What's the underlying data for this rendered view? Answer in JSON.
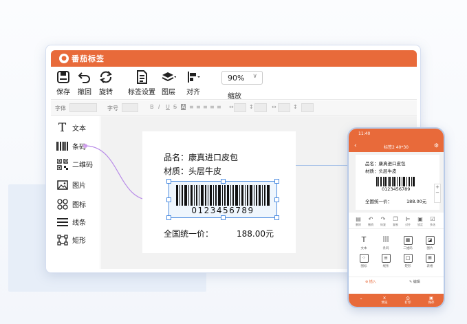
{
  "app": {
    "name": "番茄标签"
  },
  "toolbar": {
    "save": "保存",
    "undo": "撤回",
    "rotate": "旋转",
    "label_settings": "标签设置",
    "layers": "图层",
    "align": "对齐",
    "zoom_value": "90%",
    "zoom_label": "缩放"
  },
  "formatbar": {
    "font": "字体",
    "size": "字号"
  },
  "sidebar": {
    "items": [
      {
        "label": "文本",
        "icon": "text-icon"
      },
      {
        "label": "条码",
        "icon": "barcode-icon"
      },
      {
        "label": "二维码",
        "icon": "qrcode-icon"
      },
      {
        "label": "图片",
        "icon": "image-icon"
      },
      {
        "label": "图标",
        "icon": "icon-grid-icon"
      },
      {
        "label": "线条",
        "icon": "lines-icon"
      },
      {
        "label": "矩形",
        "icon": "rectangle-icon"
      }
    ]
  },
  "label": {
    "product_line": "品名：康真进口皮包",
    "material_line": "材质：头层牛皮",
    "barcode_number": "0123456789",
    "price_label": "全国统一价：",
    "price_value": "188.00元"
  },
  "phone": {
    "time": "11:40",
    "title": "标签2 40*30",
    "product_line": "品名：康真进口皮包",
    "material_line": "材质：头层牛皮",
    "barcode_number": "0123456789",
    "price_label": "全国统一价：",
    "price_value": "188.00元",
    "tools_row": [
      "删除",
      "撤销",
      "恢复",
      "复制",
      "对齐",
      "锁定",
      "多选"
    ],
    "grid": [
      "文本",
      "条码",
      "二维码",
      "图片",
      "图标",
      "线条",
      "矩形",
      "表格"
    ],
    "tab_insert": "插入",
    "tab_edit": "编辑",
    "bottom": [
      "",
      "预览",
      "打印",
      "保存"
    ]
  },
  "colors": {
    "brand": "#e86a3a",
    "selection": "#4a8be0",
    "connector": "#b88be8"
  }
}
